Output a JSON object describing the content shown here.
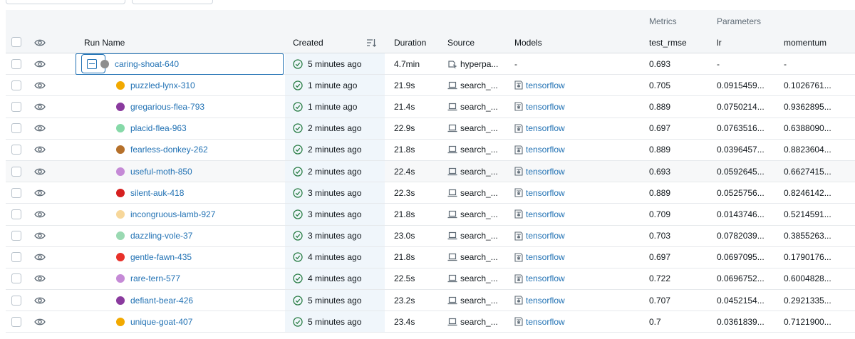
{
  "groups": {
    "metrics": "Metrics",
    "parameters": "Parameters"
  },
  "columns": {
    "run_name": "Run Name",
    "created": "Created",
    "duration": "Duration",
    "source": "Source",
    "models": "Models",
    "test_rmse": "test_rmse",
    "lr": "lr",
    "momentum": "momentum"
  },
  "parent": {
    "name": "caring-shoat-640",
    "dot_color": "#8e8e8e",
    "created": "5 minutes ago",
    "duration": "4.7min",
    "source": "hyperpa...",
    "models": "-",
    "test_rmse": "0.693",
    "lr": "-",
    "momentum": "-"
  },
  "runs": [
    {
      "name": "puzzled-lynx-310",
      "color": "#f2a900",
      "created": "1 minute ago",
      "duration": "21.9s",
      "source": "search_...",
      "model": "tensorflow",
      "test_rmse": "0.705",
      "lr": "0.0915459...",
      "momentum": "0.1026761..."
    },
    {
      "name": "gregarious-flea-793",
      "color": "#8a3a9e",
      "created": "1 minute ago",
      "duration": "21.4s",
      "source": "search_...",
      "model": "tensorflow",
      "test_rmse": "0.889",
      "lr": "0.0750214...",
      "momentum": "0.9362895..."
    },
    {
      "name": "placid-flea-963",
      "color": "#86d9a8",
      "created": "2 minutes ago",
      "duration": "22.9s",
      "source": "search_...",
      "model": "tensorflow",
      "test_rmse": "0.697",
      "lr": "0.0763516...",
      "momentum": "0.6388090..."
    },
    {
      "name": "fearless-donkey-262",
      "color": "#b5702a",
      "created": "2 minutes ago",
      "duration": "21.8s",
      "source": "search_...",
      "model": "tensorflow",
      "test_rmse": "0.889",
      "lr": "0.0396457...",
      "momentum": "0.8823604..."
    },
    {
      "name": "useful-moth-850",
      "color": "#c58ad6",
      "created": "2 minutes ago",
      "duration": "22.4s",
      "source": "search_...",
      "model": "tensorflow",
      "test_rmse": "0.693",
      "lr": "0.0592645...",
      "momentum": "0.6627415..."
    },
    {
      "name": "silent-auk-418",
      "color": "#d62020",
      "created": "3 minutes ago",
      "duration": "22.3s",
      "source": "search_...",
      "model": "tensorflow",
      "test_rmse": "0.889",
      "lr": "0.0525756...",
      "momentum": "0.8246142..."
    },
    {
      "name": "incongruous-lamb-927",
      "color": "#f7d79a",
      "created": "3 minutes ago",
      "duration": "21.8s",
      "source": "search_...",
      "model": "tensorflow",
      "test_rmse": "0.709",
      "lr": "0.0143746...",
      "momentum": "0.5214591..."
    },
    {
      "name": "dazzling-vole-37",
      "color": "#9ad9b2",
      "created": "3 minutes ago",
      "duration": "23.0s",
      "source": "search_...",
      "model": "tensorflow",
      "test_rmse": "0.703",
      "lr": "0.0782039...",
      "momentum": "0.3855263..."
    },
    {
      "name": "gentle-fawn-435",
      "color": "#e8312a",
      "created": "4 minutes ago",
      "duration": "21.8s",
      "source": "search_...",
      "model": "tensorflow",
      "test_rmse": "0.697",
      "lr": "0.0697095...",
      "momentum": "0.1790176..."
    },
    {
      "name": "rare-tern-577",
      "color": "#c58ad6",
      "created": "4 minutes ago",
      "duration": "22.5s",
      "source": "search_...",
      "model": "tensorflow",
      "test_rmse": "0.722",
      "lr": "0.0696752...",
      "momentum": "0.6004828..."
    },
    {
      "name": "defiant-bear-426",
      "color": "#8a3a9e",
      "created": "5 minutes ago",
      "duration": "23.2s",
      "source": "search_...",
      "model": "tensorflow",
      "test_rmse": "0.707",
      "lr": "0.0452154...",
      "momentum": "0.2921335..."
    },
    {
      "name": "unique-goat-407",
      "color": "#f2a900",
      "created": "5 minutes ago",
      "duration": "23.4s",
      "source": "search_...",
      "model": "tensorflow",
      "test_rmse": "0.7",
      "lr": "0.0361839...",
      "momentum": "0.7121900..."
    }
  ]
}
